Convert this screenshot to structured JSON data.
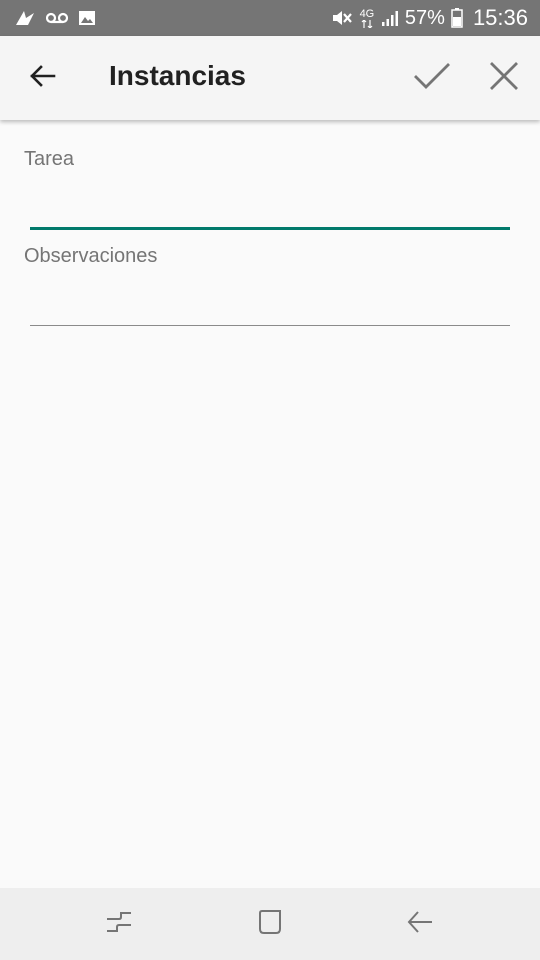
{
  "status_bar": {
    "battery_percent": "57%",
    "time": "15:36",
    "network": "4G",
    "icons_left": [
      "notification-app-icon",
      "voicemail-icon",
      "image-icon"
    ],
    "icons_right": [
      "mute-icon",
      "network-4g-icon",
      "signal-icon",
      "battery-icon"
    ]
  },
  "app_bar": {
    "title": "Instancias",
    "back_icon": "arrow-back-icon",
    "confirm_icon": "check-icon",
    "close_icon": "close-icon"
  },
  "form": {
    "fields": [
      {
        "label": "Tarea",
        "value": "",
        "placeholder": ""
      },
      {
        "label": "Observaciones",
        "value": "",
        "placeholder": ""
      }
    ]
  },
  "nav_bar": {
    "icons": [
      "recents-icon",
      "home-icon",
      "nav-back-icon"
    ]
  },
  "colors": {
    "status_bar_bg": "#757575",
    "app_bar_bg": "#f5f5f5",
    "accent": "#00796b",
    "background": "#fafafa",
    "nav_bar_bg": "#eeeeee"
  }
}
